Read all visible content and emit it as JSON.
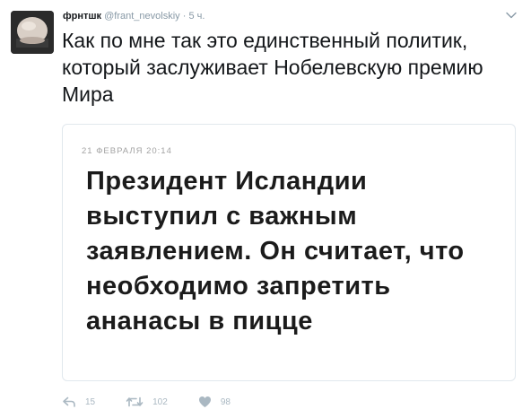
{
  "tweet": {
    "display_name": "фрнтшк",
    "handle": "@frant_nevolskiy",
    "separator": "·",
    "time": "5 ч.",
    "text": "Как по мне так это единственный политик, который заслуживает Нобелевскую премию Мира"
  },
  "card": {
    "date": "21 ФЕВРАЛЯ 20:14",
    "headline": "Президент Исландии выступил с важным заявлением. Он считает, что необходимо запретить ананасы в пицце"
  },
  "actions": {
    "reply": {
      "icon": "reply-icon",
      "count": "15"
    },
    "retweet": {
      "icon": "retweet-icon",
      "count": "102"
    },
    "like": {
      "icon": "heart-icon",
      "count": "98"
    }
  },
  "colors": {
    "text": "#14171a",
    "muted": "#8899a6",
    "action_gray": "#aab8c2",
    "card_border": "#e1e8ed",
    "headline": "#1b1b1b"
  }
}
